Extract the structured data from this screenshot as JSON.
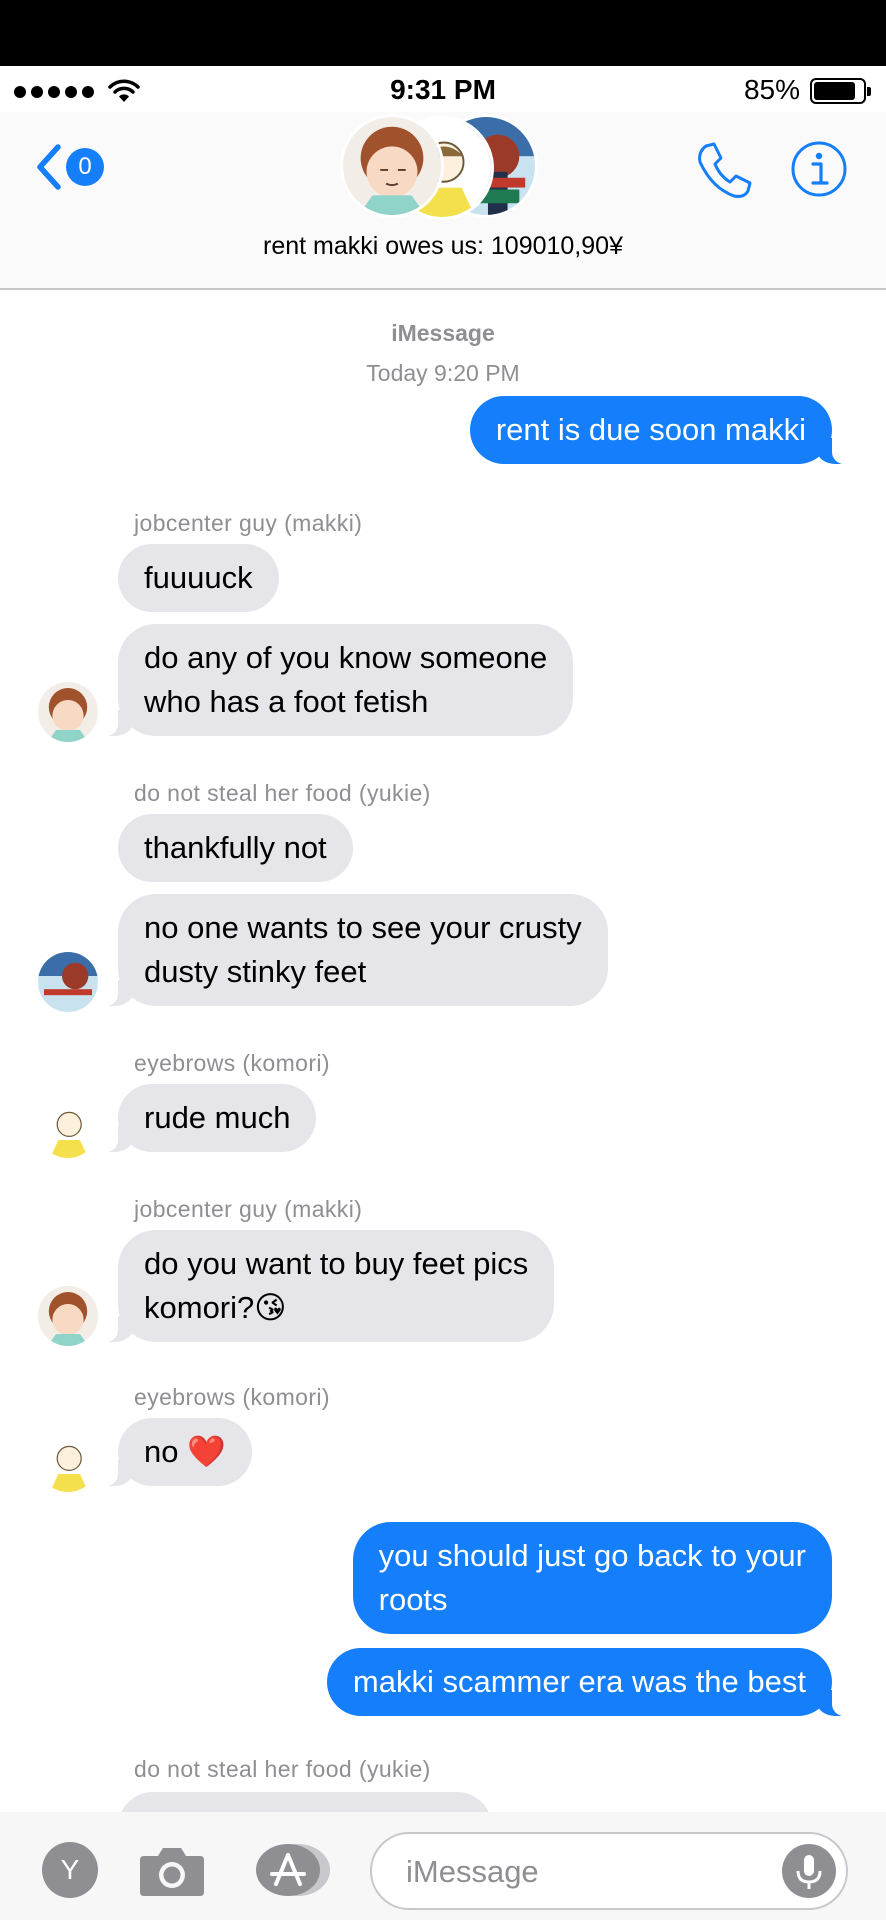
{
  "status": {
    "time": "9:31 PM",
    "battery": "85%",
    "battery_level": 0.85
  },
  "header": {
    "back_count": "0",
    "group_name": "rent makki owes us: 109010,90¥"
  },
  "thread": {
    "service": "iMessage",
    "timestamp": "Today 9:20 PM",
    "items": [
      {
        "kind": "out",
        "text": "rent is due soon makki"
      },
      {
        "kind": "sender",
        "text": "jobcenter guy (makki)"
      },
      {
        "kind": "in",
        "text": "fuuuuck"
      },
      {
        "kind": "in",
        "text": "do any of you know someone\nwho has a foot fetish"
      },
      {
        "kind": "sender",
        "text": "do not steal her food (yukie)"
      },
      {
        "kind": "in",
        "text": "thankfully not"
      },
      {
        "kind": "in",
        "text": "no one wants to see your crusty\ndusty stinky feet"
      },
      {
        "kind": "sender",
        "text": "eyebrows (komori)"
      },
      {
        "kind": "in",
        "text": "rude much"
      },
      {
        "kind": "sender",
        "text": "jobcenter guy (makki)"
      },
      {
        "kind": "in",
        "text": "do you want to buy feet pics\nkomori?😘"
      },
      {
        "kind": "sender",
        "text": "eyebrows (komori)"
      },
      {
        "kind": "in",
        "text": "no ❤️"
      },
      {
        "kind": "out",
        "text": "you should just go back to your\nroots"
      },
      {
        "kind": "out",
        "text": "makki scammer era was the best"
      },
      {
        "kind": "sender",
        "text": "do not steal her food (yukie)"
      }
    ]
  },
  "input": {
    "placeholder": "iMessage",
    "app_letter": "Y"
  },
  "colors": {
    "accent": "#147efb",
    "incoming": "#e5e5ea",
    "meta": "#8e8e93"
  }
}
